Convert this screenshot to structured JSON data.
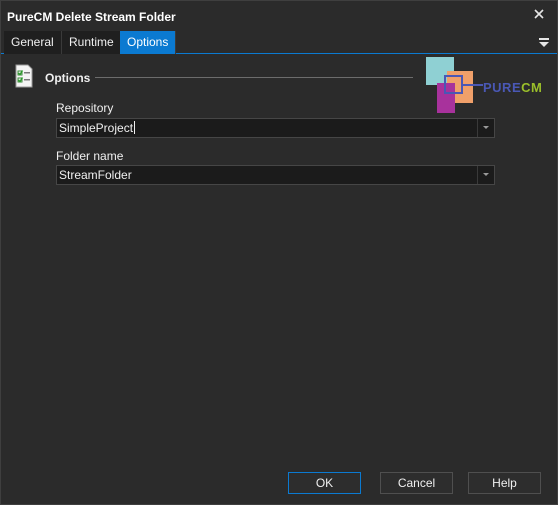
{
  "window": {
    "title": "PureCM Delete Stream Folder"
  },
  "tabs": [
    {
      "label": "General",
      "active": false
    },
    {
      "label": "Runtime",
      "active": false
    },
    {
      "label": "Options",
      "active": true
    }
  ],
  "section": {
    "title": "Options"
  },
  "logo": {
    "text_pure": "PURE",
    "text_cm": "CM"
  },
  "fields": {
    "repository": {
      "label": "Repository",
      "value": "SimpleProject"
    },
    "folder_name": {
      "label": "Folder name",
      "value": "StreamFolder"
    }
  },
  "buttons": {
    "ok": "OK",
    "cancel": "Cancel",
    "help": "Help"
  },
  "colors": {
    "accent": "#0b7ad1",
    "background": "#2b2b2b",
    "field": "#1b1b1b"
  }
}
